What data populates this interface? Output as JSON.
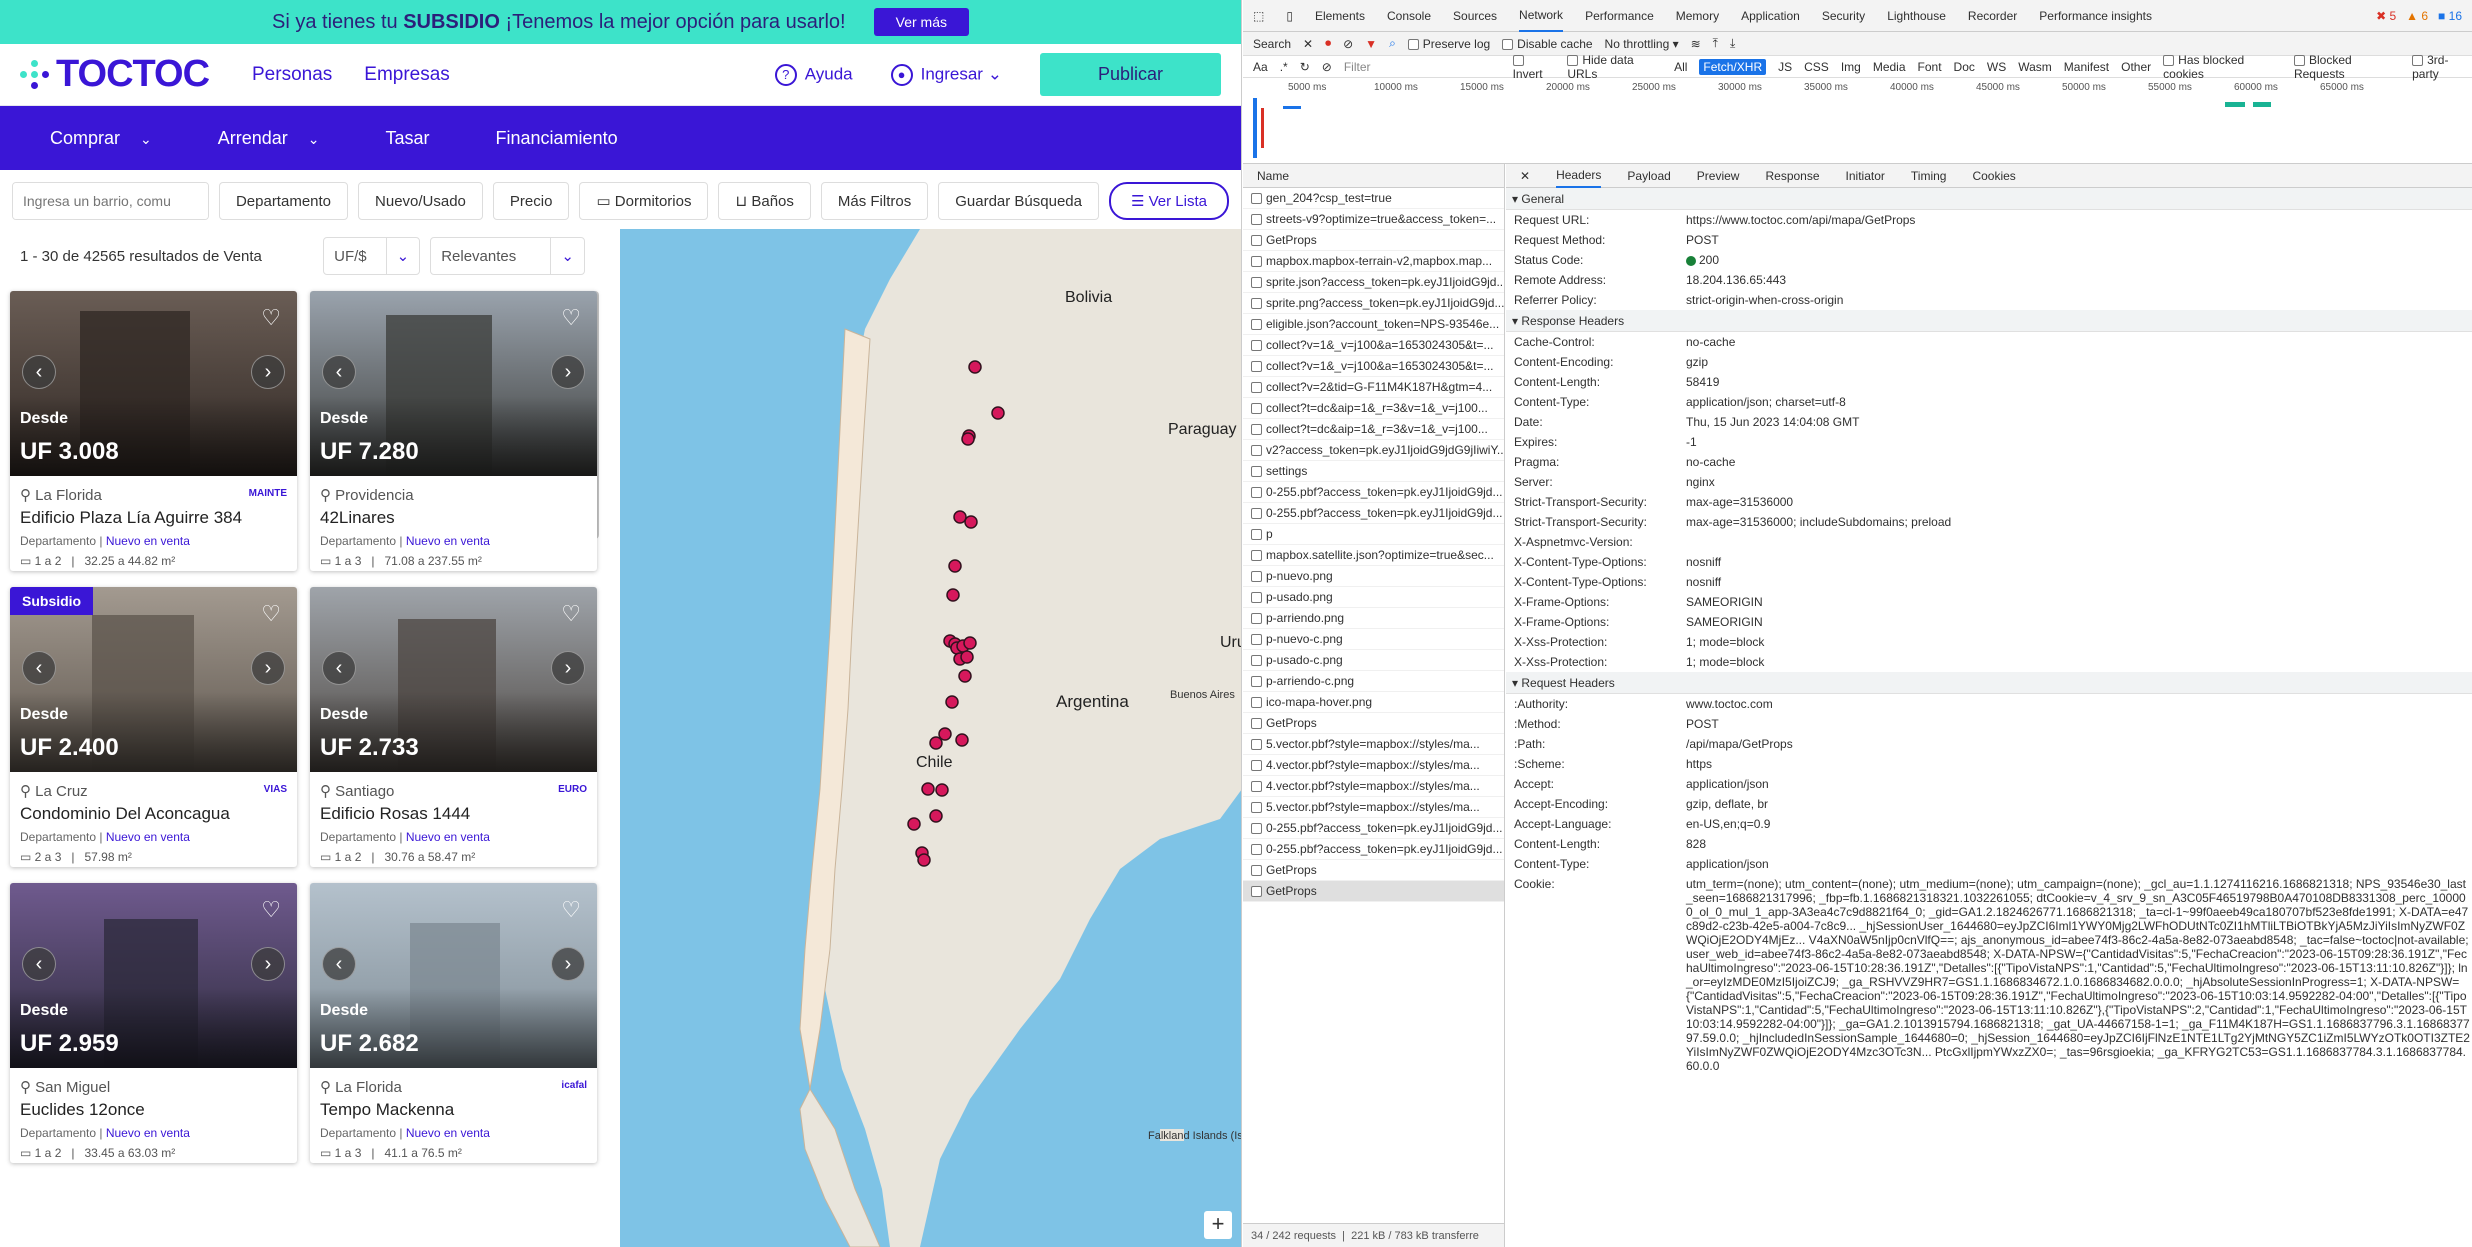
{
  "banner": {
    "text_pre": "Si ya tienes tu ",
    "text_bold": "SUBSIDIO",
    "text_post": " ¡Tenemos la mejor opción para usarlo!",
    "button": "Ver más"
  },
  "header": {
    "logo": "TOCTOC",
    "nav": [
      "Personas",
      "Empresas"
    ],
    "ayuda": "Ayuda",
    "ingresar": "Ingresar",
    "publicar": "Publicar"
  },
  "menu": [
    "Comprar",
    "Arrendar",
    "Tasar",
    "Financiamiento"
  ],
  "filters": {
    "search_placeholder": "Ingresa un barrio, comu",
    "buttons": [
      "Departamento",
      "Nuevo/Usado",
      "Precio",
      "Dormitorios",
      "Baños",
      "Más Filtros",
      "Guardar Búsqueda"
    ],
    "ver_lista": "Ver Lista"
  },
  "results": {
    "count": "1 - 30 de 42565 resultados de Venta",
    "currency": "UF/$",
    "sort": "Relevantes"
  },
  "cards": [
    {
      "desde": "Desde",
      "price": "UF 3.008",
      "location": "La Florida",
      "name": "Edificio Plaza Lía Aguirre 384",
      "type": "Departamento",
      "status": "Nuevo en venta",
      "rooms": "1 a 2",
      "area": "32.25 a 44.82 m²",
      "brand": "MAINTE",
      "subsidio": ""
    },
    {
      "desde": "Desde",
      "price": "UF 7.280",
      "location": "Providencia",
      "name": "42Linares",
      "type": "Departamento",
      "status": "Nuevo en venta",
      "rooms": "1 a 3",
      "area": "71.08 a 237.55 m²",
      "brand": "",
      "subsidio": ""
    },
    {
      "desde": "Desde",
      "price": "UF 2.400",
      "location": "La Cruz",
      "name": "Condominio Del Aconcagua",
      "type": "Departamento",
      "status": "Nuevo en venta",
      "rooms": "2 a 3",
      "area": "57.98 m²",
      "brand": "VIAS",
      "subsidio": "Subsidio"
    },
    {
      "desde": "Desde",
      "price": "UF 2.733",
      "location": "Santiago",
      "name": "Edificio Rosas 1444",
      "type": "Departamento",
      "status": "Nuevo en venta",
      "rooms": "1 a 2",
      "area": "30.76 a 58.47 m²",
      "brand": "EURO",
      "subsidio": ""
    },
    {
      "desde": "Desde",
      "price": "UF 2.959",
      "location": "San Miguel",
      "name": "Euclides 12once",
      "type": "Departamento",
      "status": "Nuevo en venta",
      "rooms": "1 a 2",
      "area": "33.45 a 63.03 m²",
      "brand": "",
      "subsidio": ""
    },
    {
      "desde": "Desde",
      "price": "UF 2.682",
      "location": "La Florida",
      "name": "Tempo Mackenna",
      "type": "Departamento",
      "status": "Nuevo en venta",
      "rooms": "1 a 3",
      "area": "41.1 a 76.5 m²",
      "brand": "icafal",
      "subsidio": ""
    }
  ],
  "map": {
    "labels": [
      "Bolivia",
      "Paraguay",
      "Argentina",
      "Chile",
      "Buenos Aires",
      "Uru",
      "Falkland Islands (Islas Malvinas)"
    ],
    "zoom": "+"
  },
  "devtools": {
    "tabs": [
      "Elements",
      "Console",
      "Sources",
      "Network",
      "Performance",
      "Memory",
      "Application",
      "Security",
      "Lighthouse",
      "Recorder",
      "Performance insights"
    ],
    "counts": {
      "errors": "5",
      "warnings": "6",
      "info": "16"
    },
    "toolbar": {
      "search": "Search",
      "preserve_log": "Preserve log",
      "disable_cache": "Disable cache",
      "throttling": "No throttling"
    },
    "filterbar": {
      "placeholder": "Filter",
      "invert": "Invert",
      "hide_data": "Hide data URLs",
      "types": [
        "All",
        "Fetch/XHR",
        "JS",
        "CSS",
        "Img",
        "Media",
        "Font",
        "Doc",
        "WS",
        "Wasm",
        "Manifest",
        "Other"
      ],
      "blocked_cookies": "Has blocked cookies",
      "blocked_requests": "Blocked Requests",
      "third_party": "3rd-party"
    },
    "timeline_ticks": [
      "5000 ms",
      "10000 ms",
      "15000 ms",
      "20000 ms",
      "25000 ms",
      "30000 ms",
      "35000 ms",
      "40000 ms",
      "45000 ms",
      "50000 ms",
      "55000 ms",
      "60000 ms",
      "65000 ms"
    ],
    "name_header": "Name",
    "requests": [
      "gen_204?csp_test=true",
      "streets-v9?optimize=true&access_token=...",
      "GetProps",
      "mapbox.mapbox-terrain-v2,mapbox.map...",
      "sprite.json?access_token=pk.eyJ1IjoidG9jd...",
      "sprite.png?access_token=pk.eyJ1IjoidG9jd...",
      "eligible.json?account_token=NPS-93546e...",
      "collect?v=1&_v=j100&a=1653024305&t=...",
      "collect?v=1&_v=j100&a=1653024305&t=...",
      "collect?v=2&tid=G-F11M4K187H&gtm=4...",
      "collect?t=dc&aip=1&_r=3&v=1&_v=j100...",
      "collect?t=dc&aip=1&_r=3&v=1&_v=j100...",
      "v2?access_token=pk.eyJ1IjoidG9jdG9jIiwiY...",
      "settings",
      "0-255.pbf?access_token=pk.eyJ1IjoidG9jd...",
      "0-255.pbf?access_token=pk.eyJ1IjoidG9jd...",
      "p",
      "mapbox.satellite.json?optimize=true&sec...",
      "p-nuevo.png",
      "p-usado.png",
      "p-arriendo.png",
      "p-nuevo-c.png",
      "p-usado-c.png",
      "p-arriendo-c.png",
      "ico-mapa-hover.png",
      "GetProps",
      "5.vector.pbf?style=mapbox://styles/ma...",
      "4.vector.pbf?style=mapbox://styles/ma...",
      "4.vector.pbf?style=mapbox://styles/ma...",
      "5.vector.pbf?style=mapbox://styles/ma...",
      "0-255.pbf?access_token=pk.eyJ1IjoidG9jd...",
      "0-255.pbf?access_token=pk.eyJ1IjoidG9jd...",
      "GetProps",
      "GetProps"
    ],
    "footer": {
      "requests": "34 / 242 requests",
      "transferred": "221 kB / 783 kB transferre"
    },
    "detail_tabs": [
      "Headers",
      "Payload",
      "Preview",
      "Response",
      "Initiator",
      "Timing",
      "Cookies"
    ],
    "general_title": "General",
    "general": [
      {
        "k": "Request URL:",
        "v": "https://www.toctoc.com/api/mapa/GetProps"
      },
      {
        "k": "Request Method:",
        "v": "POST"
      },
      {
        "k": "Status Code:",
        "v": "200"
      },
      {
        "k": "Remote Address:",
        "v": "18.204.136.65:443"
      },
      {
        "k": "Referrer Policy:",
        "v": "strict-origin-when-cross-origin"
      }
    ],
    "response_title": "Response Headers",
    "response": [
      {
        "k": "Cache-Control:",
        "v": "no-cache"
      },
      {
        "k": "Content-Encoding:",
        "v": "gzip"
      },
      {
        "k": "Content-Length:",
        "v": "58419"
      },
      {
        "k": "Content-Type:",
        "v": "application/json; charset=utf-8"
      },
      {
        "k": "Date:",
        "v": "Thu, 15 Jun 2023 14:04:08 GMT"
      },
      {
        "k": "Expires:",
        "v": "-1"
      },
      {
        "k": "Pragma:",
        "v": "no-cache"
      },
      {
        "k": "Server:",
        "v": "nginx"
      },
      {
        "k": "Strict-Transport-Security:",
        "v": "max-age=31536000"
      },
      {
        "k": "Strict-Transport-Security:",
        "v": "max-age=31536000; includeSubdomains; preload"
      },
      {
        "k": "X-Aspnetmvc-Version:",
        "v": ""
      },
      {
        "k": "X-Content-Type-Options:",
        "v": "nosniff"
      },
      {
        "k": "X-Content-Type-Options:",
        "v": "nosniff"
      },
      {
        "k": "X-Frame-Options:",
        "v": "SAMEORIGIN"
      },
      {
        "k": "X-Frame-Options:",
        "v": "SAMEORIGIN"
      },
      {
        "k": "X-Xss-Protection:",
        "v": "1; mode=block"
      },
      {
        "k": "X-Xss-Protection:",
        "v": "1; mode=block"
      }
    ],
    "request_title": "Request Headers",
    "request": [
      {
        "k": ":Authority:",
        "v": "www.toctoc.com"
      },
      {
        "k": ":Method:",
        "v": "POST"
      },
      {
        "k": ":Path:",
        "v": "/api/mapa/GetProps"
      },
      {
        "k": ":Scheme:",
        "v": "https"
      },
      {
        "k": "Accept:",
        "v": "application/json"
      },
      {
        "k": "Accept-Encoding:",
        "v": "gzip, deflate, br"
      },
      {
        "k": "Accept-Language:",
        "v": "en-US,en;q=0.9"
      },
      {
        "k": "Content-Length:",
        "v": "828"
      },
      {
        "k": "Content-Type:",
        "v": "application/json"
      },
      {
        "k": "Cookie:",
        "v": "utm_term=(none); utm_content=(none); utm_medium=(none); utm_campaign=(none); _gcl_au=1.1.1274116216.1686821318; NPS_93546e30_last_seen=1686821317996; _fbp=fb.1.1686821318321.1032261055; dtCookie=v_4_srv_9_sn_A3C05F46519798B0A470108DB8331308_perc_100000_ol_0_mul_1_app-3A3ea4c7c9d8821f64_0; _gid=GA1.2.1824626771.1686821318; _ta=cl-1~99f0aeeb49ca180707bf523e8fde1991; X-DATA=e47c89d2-c23b-42e5-a004-7c8c9... _hjSessionUser_1644680=eyJpZCI6Iml1YWY0Mjg2LWFhODUtNTc0ZI1hMTliLTBiOTBkYjA5MzJiYiIsImNyZWF0ZWQiOjE2ODY4MjEz... V4aXN0aW5nIjp0cnVlfQ==; ajs_anonymous_id=abee74f3-86c2-4a5a-8e82-073aeabd8548; _tac=false~toctoc|not-available; user_web_id=abee74f3-86c2-4a5a-8e82-073aeabd8548; X-DATA-NPSW={\"CantidadVisitas\":5,\"FechaCreacion\":\"2023-06-15T09:28:36.191Z\",\"FechaUltimoIngreso\":\"2023-06-15T10:28:36.191Z\",\"Detalles\":[{\"TipoVistaNPS\":1,\"Cantidad\":5,\"FechaUltimoIngreso\":\"2023-06-15T13:11:10.826Z\"}]}; ln_or=eyIzMDE0MzI5IjoiZCJ9; _ga_RSHVVZ9HR7=GS1.1.1686834672.1.0.1686834682.0.0.0; _hjAbsoluteSessionInProgress=1; X-DATA-NPSW={\"CantidadVisitas\":5,\"FechaCreacion\":\"2023-06-15T09:28:36.191Z\",\"FechaUltimoIngreso\":\"2023-06-15T10:03:14.9592282-04:00\",\"Detalles\":[{\"TipoVistaNPS\":1,\"Cantidad\":5,\"FechaUltimoIngreso\":\"2023-06-15T13:11:10.826Z\"},{\"TipoVistaNPS\":2,\"Cantidad\":1,\"FechaUltimoIngreso\":\"2023-06-15T10:03:14.9592282-04:00\"}]}; _ga=GA1.2.1013915794.1686821318; _gat_UA-44667158-1=1; _ga_F11M4K187H=GS1.1.1686837796.3.1.1686837797.59.0.0; _hjIncludedInSessionSample_1644680=0; _hjSession_1644680=eyJpZCI6IjFlNzE1NTE1LTg2YjMtNGY5ZC1iZmI5LWYzOTk0OTI3ZTE2YiIsImNyZWF0ZWQiOjE2ODY4Mzc3OTc3N... PtcGxlIjpmYWxzZX0=; _tas=96rsgioekia; _ga_KFRYG2TC53=GS1.1.1686837784.3.1.1686837784.60.0.0"
      }
    ]
  }
}
